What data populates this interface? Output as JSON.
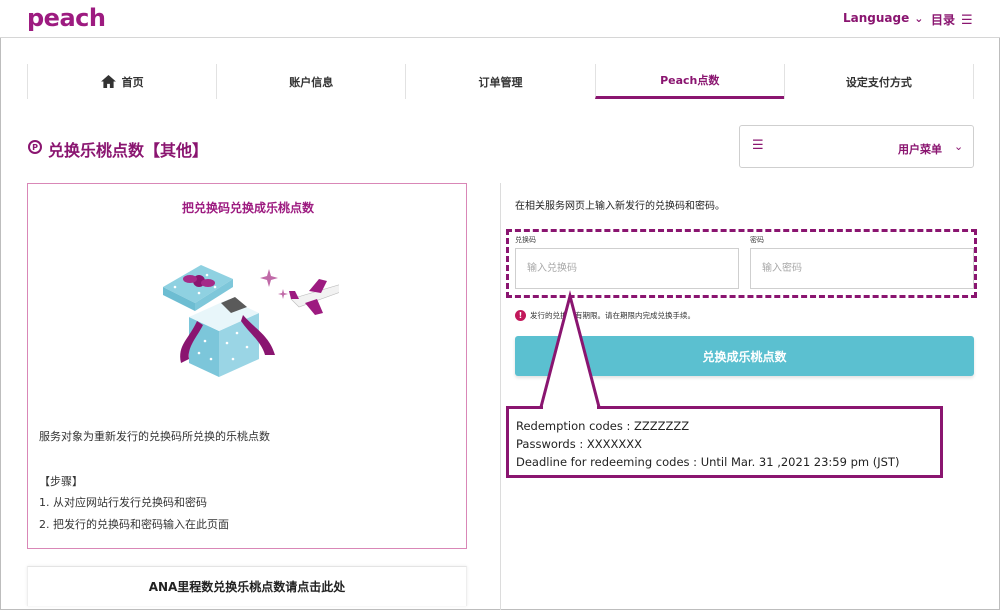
{
  "header": {
    "logo": "peach",
    "language_label": "Language",
    "menu_label": "目录"
  },
  "tabs": [
    {
      "label": "首页",
      "icon": "home-icon"
    },
    {
      "label": "账户信息"
    },
    {
      "label": "订单管理"
    },
    {
      "label": "Peach点数",
      "active": true
    },
    {
      "label": "设定支付方式"
    }
  ],
  "page": {
    "title": "兑换乐桃点数【其他】",
    "title_icon": "P",
    "user_menu_label": "用户菜单"
  },
  "left_card": {
    "title": "把兑换码兑换成乐桃点数",
    "description": "服务对象为重新发行的兑换码所兑换的乐桃点数",
    "steps_heading": "【步骤】",
    "step1": "1. 从对应网站行发行兑换码和密码",
    "step2": "2. 把发行的兑换码和密码输入在此页面"
  },
  "ana_button": "ANA里程数兑换乐桃点数请点击此处",
  "form": {
    "instruction": "在相关服务网页上输入新发行的兑换码和密码。",
    "code_label": "兑换码",
    "code_placeholder": "输入兑换码",
    "password_label": "密码",
    "password_placeholder": "输入密码",
    "warning": "发行的兑换码有期限。请在期限内完成兑换手续。",
    "submit_label": "兑换成乐桃点数"
  },
  "callout": {
    "line1": "Redemption codes : ZZZZZZZ",
    "line2": "Passwords : XXXXXXX",
    "line3": "Deadline for redeeming codes : Until Mar. 31 ,2021 23:59 pm (JST)"
  },
  "colors": {
    "brand": "#8a1570",
    "button": "#5bc0d0",
    "card_border": "#d987b7"
  }
}
